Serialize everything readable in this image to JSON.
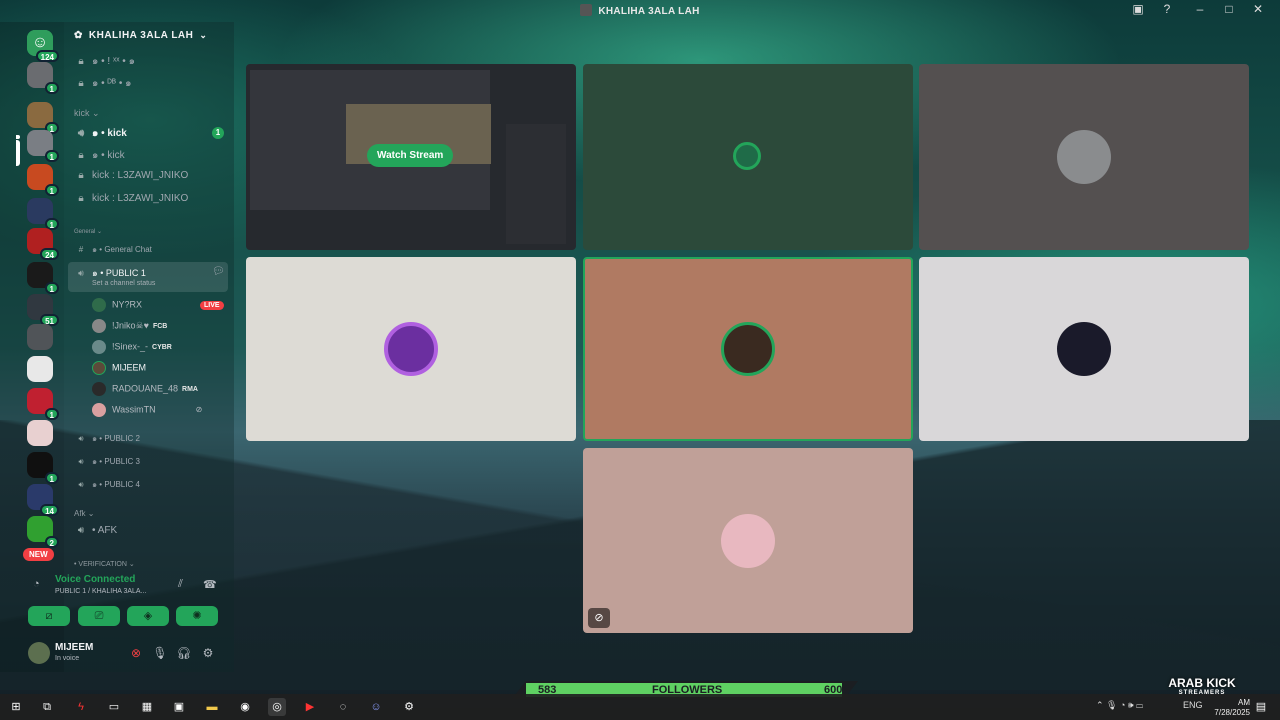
{
  "window": {
    "title": "KHALIHA 3ALA LAH"
  },
  "rail": {
    "badges": [
      "124",
      "1",
      "1",
      "1",
      "1",
      "1",
      "1",
      "24",
      "1",
      "51",
      "1",
      "1",
      "14",
      "2"
    ],
    "new_label": "NEW"
  },
  "server": {
    "name": "KHALIHA 3ALA LAH"
  },
  "channels": {
    "top_rows": [
      "๑ • ! ˣˣ • ๑",
      "๑ • ᴰᴮ • ๑"
    ],
    "category_kick": "kick",
    "kick_rows": [
      "๑ • kick",
      "๑ • kick",
      "kick : L3ZAWI_JNIKO",
      "kick : L3ZAWI_JNIKO"
    ],
    "kick_unread": "1",
    "category_general": "General",
    "general_chat": "๑ • General Chat",
    "public1": "๑ • PUBLIC 1",
    "public1_status": "Set a channel status",
    "voice_users": [
      {
        "name": "NY?RX",
        "tag": ""
      },
      {
        "name": "!Jniko☠♥",
        "tag": "FCB"
      },
      {
        "name": "!Sinex-_-",
        "tag": "CYBR"
      },
      {
        "name": "MIJEEM",
        "tag": ""
      },
      {
        "name": "RADOUANE_48",
        "tag": "RMA"
      },
      {
        "name": "WassimTN",
        "tag": ""
      }
    ],
    "live_label": "LIVE",
    "public_others": [
      "๑ • PUBLIC 2",
      "๑ • PUBLIC 3",
      "๑ • PUBLIC 4"
    ],
    "category_afk": "Afk",
    "afk": "• AFK",
    "category_verification": "• VERIFICATION"
  },
  "voice": {
    "connected": "Voice Connected",
    "channel": "PUBLIC 1 / KHALIHA 3ALA..."
  },
  "user": {
    "name": "MIJEEM",
    "status": "In voice"
  },
  "stage": {
    "watch_label": "Watch Stream"
  },
  "followers": {
    "left": "583",
    "label": "FOLLOWERS",
    "right": "600",
    "progress": 0.97
  },
  "logo": {
    "line1": "ARAB KICK",
    "line2": "STREAMERS"
  },
  "taskbar": {
    "lang": "ENG",
    "time": "AM",
    "date": "7/28/2025"
  },
  "colors": {
    "accent": "#23a55a",
    "live": "#f23f43"
  }
}
